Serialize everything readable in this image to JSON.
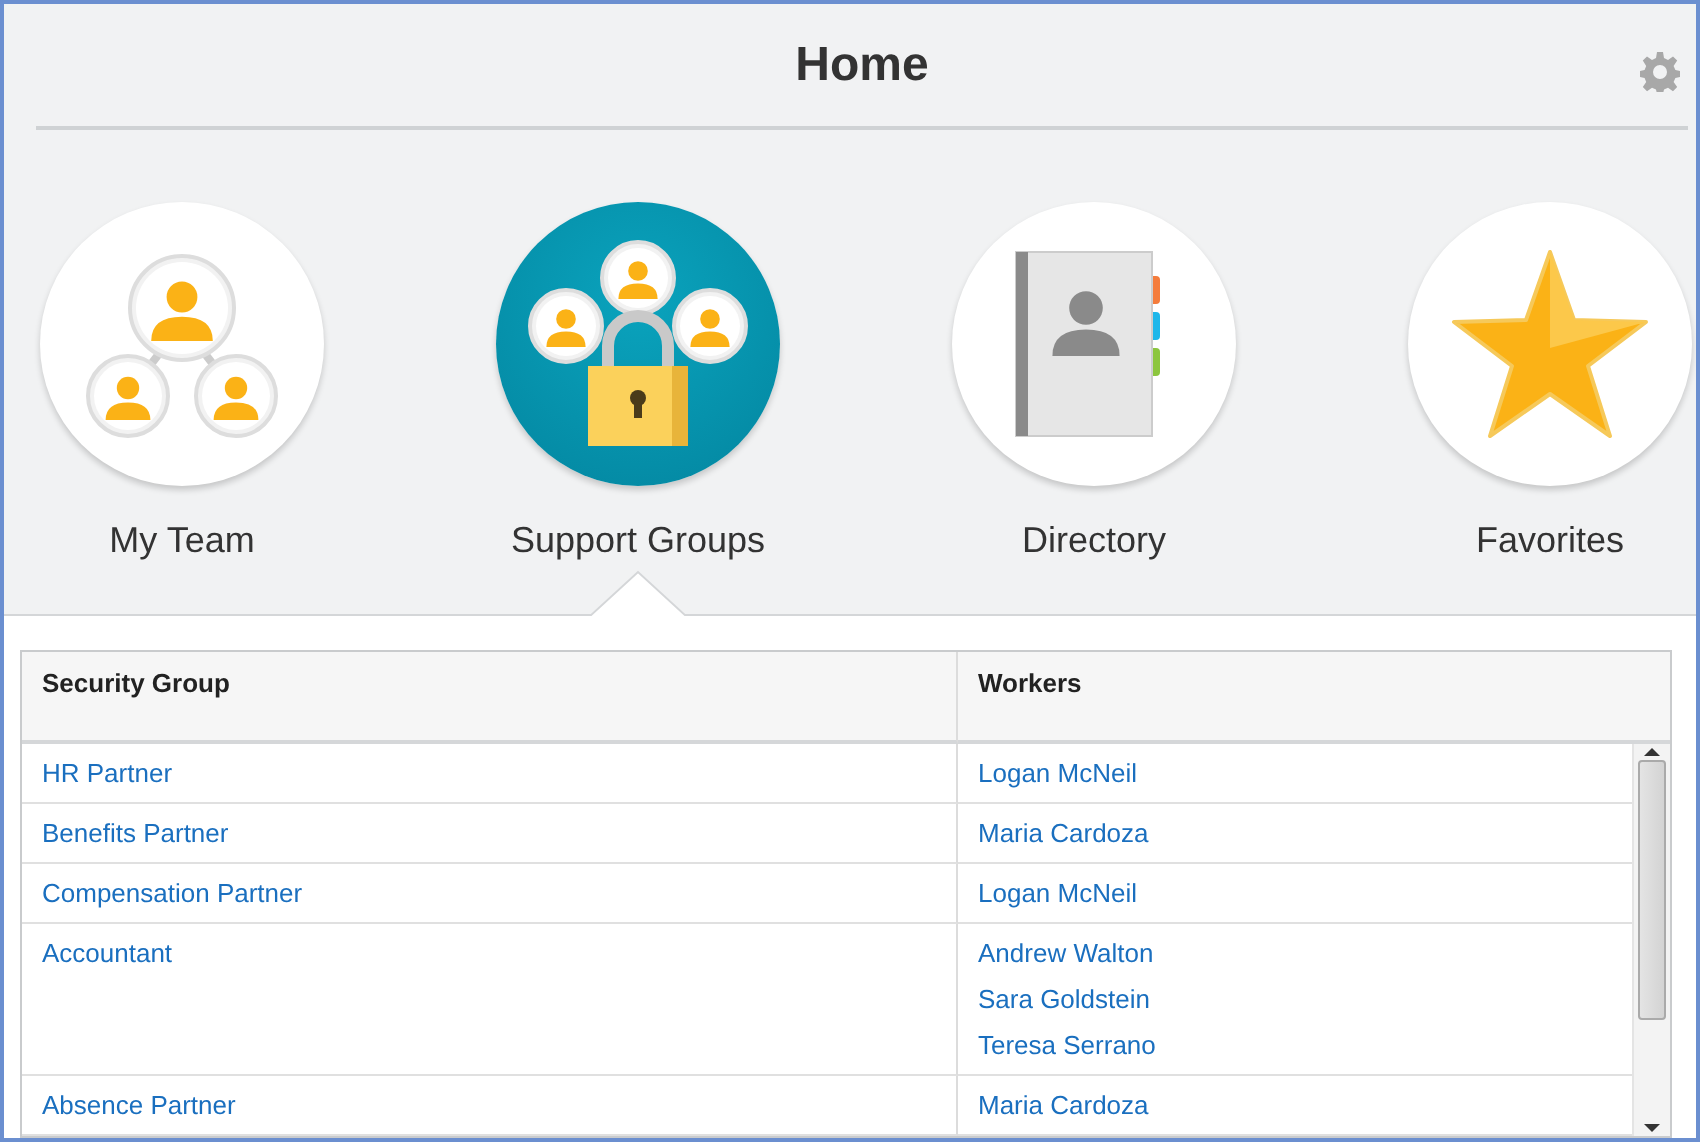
{
  "header": {
    "title": "Home"
  },
  "tiles": [
    {
      "label": "My Team",
      "kind": "team",
      "selected": false
    },
    {
      "label": "Support Groups",
      "kind": "groups",
      "selected": true
    },
    {
      "label": "Directory",
      "kind": "directory",
      "selected": false
    },
    {
      "label": "Favorites",
      "kind": "favorites",
      "selected": false
    }
  ],
  "table": {
    "columns": [
      "Security Group",
      "Workers"
    ],
    "rows": [
      {
        "group": "HR Partner",
        "workers": [
          "Logan McNeil"
        ]
      },
      {
        "group": "Benefits Partner",
        "workers": [
          "Maria Cardoza"
        ]
      },
      {
        "group": "Compensation Partner",
        "workers": [
          "Logan McNeil"
        ]
      },
      {
        "group": "Accountant",
        "workers": [
          "Andrew Walton",
          "Sara Goldstein",
          "Teresa Serrano"
        ]
      },
      {
        "group": "Absence Partner",
        "workers": [
          "Maria Cardoza"
        ]
      }
    ]
  }
}
